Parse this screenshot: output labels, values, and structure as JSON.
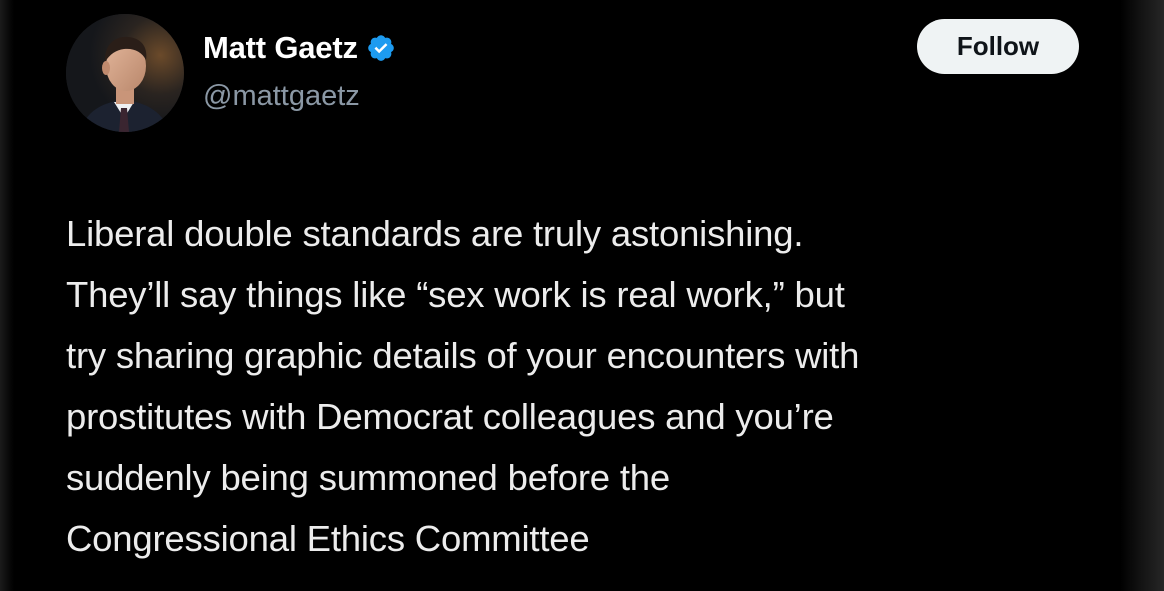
{
  "author": {
    "display_name": "Matt Gaetz",
    "handle": "@mattgaetz",
    "verified": true,
    "avatar_icon": "profile-photo"
  },
  "actions": {
    "follow_label": "Follow"
  },
  "tweet": {
    "lines": [
      "Liberal double standards are truly astonishing.",
      "They’ll say things like “sex work is real work,” but",
      "try sharing graphic details of your encounters with",
      "prostitutes with Democrat colleagues and you’re",
      "suddenly being summoned before the",
      "Congressional Ethics Committee"
    ]
  },
  "colors": {
    "background": "#000000",
    "text": "#e7e9ea",
    "handle": "#8b98a5",
    "verified_badge": "#1d9bf0",
    "follow_button_bg": "#eff3f4",
    "follow_button_text": "#0f1419"
  }
}
